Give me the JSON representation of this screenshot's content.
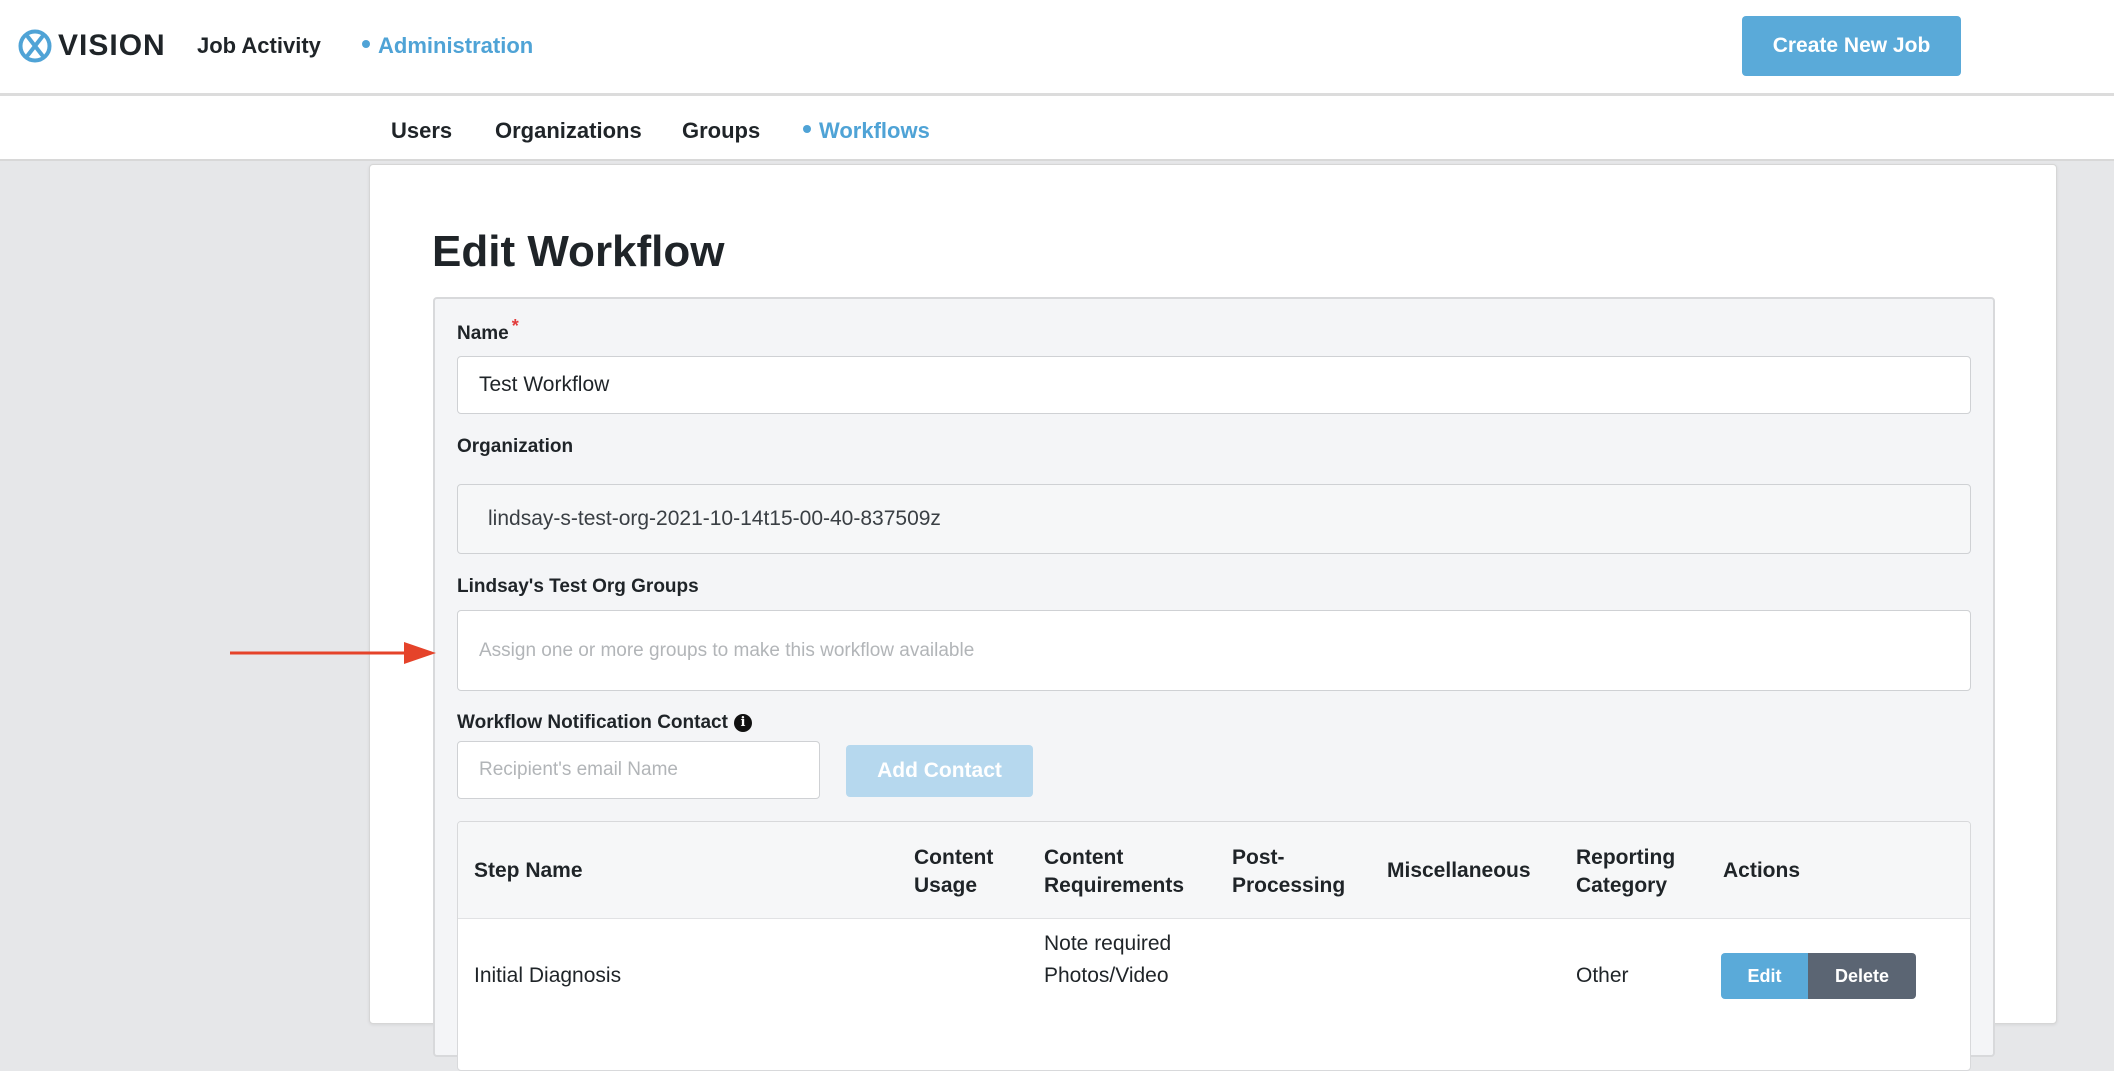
{
  "header": {
    "logo_text": "VISION",
    "nav": [
      {
        "label": "Job Activity",
        "active": false
      },
      {
        "label": "Administration",
        "active": true
      }
    ],
    "create_button": "Create New Job",
    "accent_color": "#4fa3d6"
  },
  "subnav": {
    "items": [
      {
        "label": "Users",
        "active": false
      },
      {
        "label": "Organizations",
        "active": false
      },
      {
        "label": "Groups",
        "active": false
      },
      {
        "label": "Workflows",
        "active": true
      }
    ]
  },
  "page": {
    "title": "Edit Workflow"
  },
  "form": {
    "name_label": "Name",
    "required_mark": "*",
    "name_value": "Test Workflow",
    "organization_label": "Organization",
    "organization_value": "lindsay-s-test-org-2021-10-14t15-00-40-837509z",
    "groups_label": "Lindsay's Test Org Groups",
    "groups_placeholder": "Assign one or more groups to make this workflow available",
    "contact_label": "Workflow Notification Contact",
    "contact_info_icon": "i",
    "email_placeholder": "Recipient's email Name",
    "add_contact_button": "Add Contact"
  },
  "table": {
    "columns": [
      {
        "label": "Step Name",
        "single": true
      },
      {
        "label": "Content\nUsage",
        "single": false
      },
      {
        "label": "Content\nRequirements",
        "single": false
      },
      {
        "label": "Post-\nProcessing",
        "single": false
      },
      {
        "label": "Miscellaneous",
        "single": true
      },
      {
        "label": "Reporting\nCategory",
        "single": false
      },
      {
        "label": "Actions",
        "single": true
      }
    ],
    "rows": [
      {
        "step_name": "Initial Diagnosis",
        "content_requirements_line1": "Note required",
        "content_requirements_line2": "Photos/Video",
        "reporting_category": "Other",
        "edit_label": "Edit",
        "delete_label": "Delete"
      }
    ]
  },
  "icons": {
    "logo": "vision-x-logo-icon",
    "info": "info-icon",
    "annotation": "red-arrow-annotation"
  }
}
